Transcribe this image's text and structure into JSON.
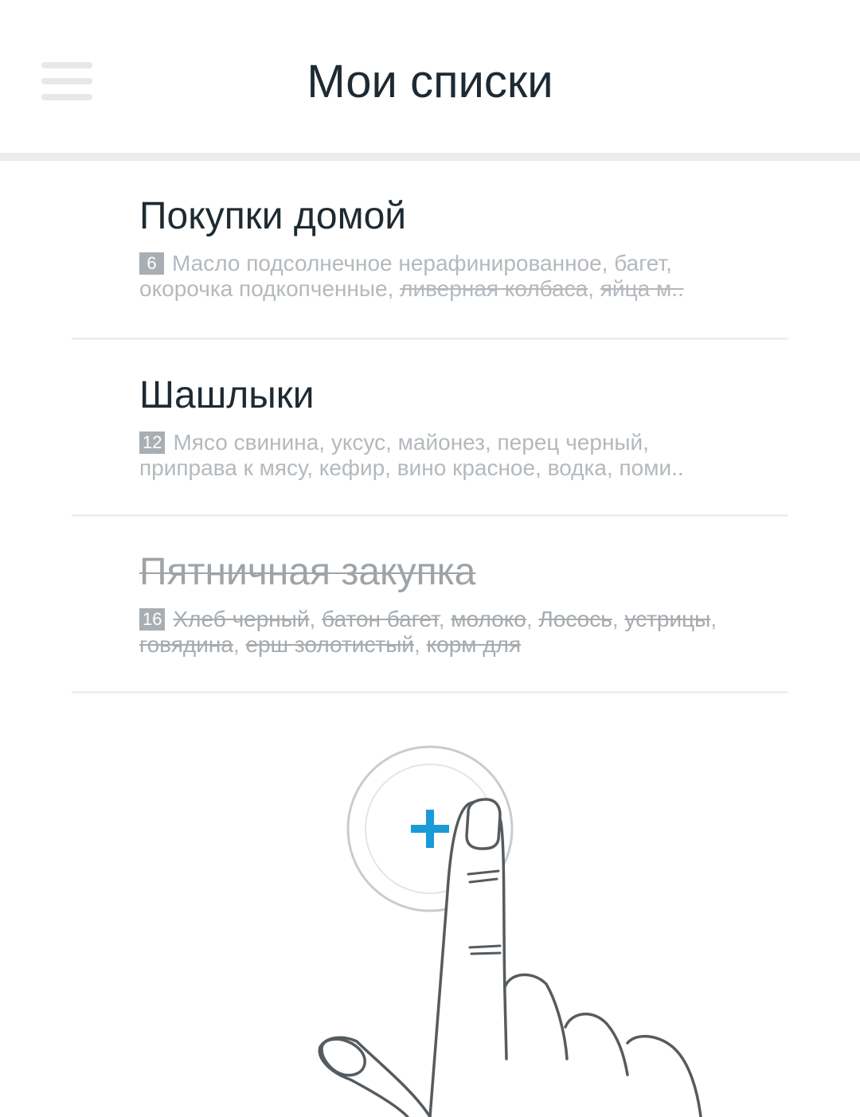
{
  "header": {
    "title": "Мои списки",
    "menu_icon": "hamburger-menu-icon"
  },
  "lists": [
    {
      "title": "Покупки домой",
      "done": false,
      "count": "6",
      "preview_parts": [
        {
          "text": "Масло подсолнечное нерафинированное, багет, окорочка подкопченные, ",
          "struck": false
        },
        {
          "text": "ливерная колбаса",
          "struck": true
        },
        {
          "text": ", ",
          "struck": false
        },
        {
          "text": "яйца м..",
          "struck": true
        }
      ]
    },
    {
      "title": "Шашлыки",
      "done": false,
      "count": "12",
      "preview_parts": [
        {
          "text": "Мясо свинина, уксус, майонез, перец черный, приправа к мясу, кефир, вино красное, водка, поми..",
          "struck": false
        }
      ]
    },
    {
      "title": "Пятничная закупка",
      "done": true,
      "count": "16",
      "preview_parts": [
        {
          "text": "Хлеб черный",
          "struck": true
        },
        {
          "text": ", ",
          "struck": false
        },
        {
          "text": "батон багет",
          "struck": true
        },
        {
          "text": ", ",
          "struck": false
        },
        {
          "text": "молоко",
          "struck": true
        },
        {
          "text": ", ",
          "struck": false
        },
        {
          "text": "Лосось",
          "struck": true
        },
        {
          "text": ", ",
          "struck": false
        },
        {
          "text": "устрицы",
          "struck": true
        },
        {
          "text": ", ",
          "struck": false
        },
        {
          "text": "говядина",
          "struck": true
        },
        {
          "text": ", ",
          "struck": false
        },
        {
          "text": "ерш золотистый",
          "struck": true
        },
        {
          "text": ", ",
          "struck": false
        },
        {
          "text": "корм для",
          "struck": true
        }
      ]
    }
  ],
  "hint": {
    "add_button_icon": "plus-icon",
    "hand_icon": "pointing-hand-icon",
    "accent_color": "#1a9ad6"
  }
}
